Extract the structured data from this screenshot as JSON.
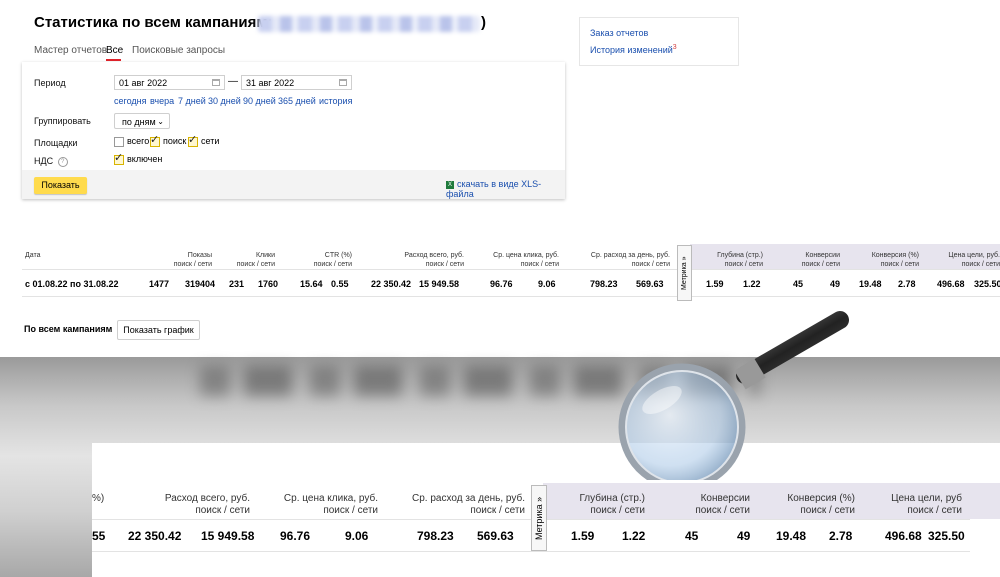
{
  "header": {
    "title": "Статистика по всем кампаниям:",
    "title_suffix": ")",
    "tabs": [
      "Мастер отчетов",
      "Все",
      "Поисковые запросы"
    ],
    "active_tab": "Все"
  },
  "side_panel": {
    "orders_link": "Заказ отчетов",
    "history_link": "История изменений",
    "history_badge": "3"
  },
  "form": {
    "period_label": "Период",
    "date_from": "01 авг 2022",
    "date_to": "31 авг 2022",
    "date_separator": "—",
    "quick_ranges": [
      "сегодня",
      "вчера",
      "7 дней",
      "30 дней",
      "90 дней",
      "365 дней",
      "история"
    ],
    "group_label": "Группировать",
    "group_value": "по дням",
    "places_label": "Площадки",
    "place_all": "всего",
    "place_search": "поиск",
    "place_networks": "сети",
    "nds_label": "НДС",
    "nds_help": "?",
    "nds_value": "включен",
    "submit": "Показать",
    "xls_link": "скачать в виде XLS-файла",
    "xls_icon": "X"
  },
  "table": {
    "headers": {
      "date": "Дата",
      "shows": "Показы",
      "clicks": "Клики",
      "ctr": "CTR (%)",
      "spend": "Расход всего, руб.",
      "cpc": "Ср. цена клика, руб.",
      "daily": "Ср. расход за день, руб.",
      "depth": "Глубина (стр.)",
      "conv": "Конверсии",
      "conv_rate": "Конверсия (%)",
      "goal_cost": "Цена цели, руб.",
      "sub": "поиск / сети",
      "sub_goal": "поиск / сети"
    },
    "metrika_tab": "Метрика »",
    "row": {
      "date": "с 01.08.22 по 31.08.22",
      "shows_search": "1477",
      "shows_networks": "319404",
      "clicks_search": "231",
      "clicks_networks": "1760",
      "ctr_search": "15.64",
      "ctr_networks": "0.55",
      "spend_search": "22 350.42",
      "spend_networks": "15 949.58",
      "cpc_search": "96.76",
      "cpc_networks": "9.06",
      "daily_search": "798.23",
      "daily_networks": "569.63",
      "depth_search": "1.59",
      "depth_networks": "1.22",
      "conv_search": "45",
      "conv_networks": "49",
      "conv_rate_search": "19.48",
      "conv_rate_networks": "2.78",
      "goal_cost_search": "496.68",
      "goal_cost_networks": "325.50"
    }
  },
  "campaigns": {
    "label": "По всем кампаниям",
    "chart_button": "Показать график"
  },
  "zoom": {
    "ctr_fragment": "%)",
    "ctr_value_fragment": "55",
    "goal_header": "Цена цели, руб"
  },
  "colors": {
    "accent_yellow": "#ffdb4d",
    "link_blue": "#1a4fae",
    "tab_underline": "#e0232b",
    "metrika_shade": "#e7e4ee"
  }
}
